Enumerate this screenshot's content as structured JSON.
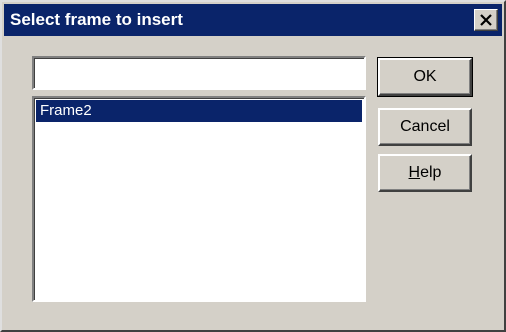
{
  "dialog": {
    "title": "Select frame to insert",
    "close_label": "×"
  },
  "input": {
    "value": ""
  },
  "list": {
    "items": [
      {
        "label": "Frame2",
        "selected": true
      }
    ]
  },
  "buttons": {
    "ok": "OK",
    "cancel": "Cancel",
    "help_accel": "H",
    "help_rest": "elp"
  },
  "colors": {
    "titlebar": "#0a246a",
    "face": "#d4d0c8",
    "selection": "#0a246a"
  }
}
